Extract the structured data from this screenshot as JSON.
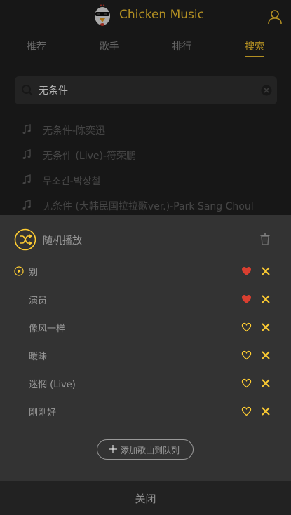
{
  "header": {
    "title": "Chicken Music"
  },
  "tabs": [
    {
      "label": "推荐"
    },
    {
      "label": "歌手"
    },
    {
      "label": "排行"
    },
    {
      "label": "搜索"
    }
  ],
  "search": {
    "value": "无条件",
    "placeholder": ""
  },
  "suggestions": [
    {
      "text": "无条件-陈奕迅"
    },
    {
      "text": "无条件 (Live)-符荣鹏"
    },
    {
      "text": "무조건-박상철"
    },
    {
      "text": "无条件 (大韩民国拉拉歌ver.)-Park Sang Choul"
    }
  ],
  "playlist": {
    "mode_label": "随机播放",
    "songs": [
      {
        "title": "别",
        "favorite": true,
        "current": true
      },
      {
        "title": "演员",
        "favorite": true,
        "current": false
      },
      {
        "title": "像风一样",
        "favorite": false,
        "current": false
      },
      {
        "title": "暧昧",
        "favorite": false,
        "current": false
      },
      {
        "title": "迷惘 (Live)",
        "favorite": false,
        "current": false
      },
      {
        "title": "刚刚好",
        "favorite": false,
        "current": false
      }
    ],
    "add_label": "添加歌曲到队列",
    "close_label": "关闭"
  },
  "colors": {
    "accent": "#ffcd32",
    "favorite": "#d93f30",
    "background": "#222222",
    "panel": "#333333"
  },
  "icons": {
    "logo": "chicken-logo-icon",
    "user": "user-icon",
    "search": "search-icon",
    "clear": "clear-icon",
    "music": "music-note-icon",
    "mode": "shuffle-icon",
    "trash": "trash-icon",
    "current": "play-circle-icon",
    "favorite": "heart-icon",
    "delete": "close-icon",
    "add": "plus-icon"
  }
}
